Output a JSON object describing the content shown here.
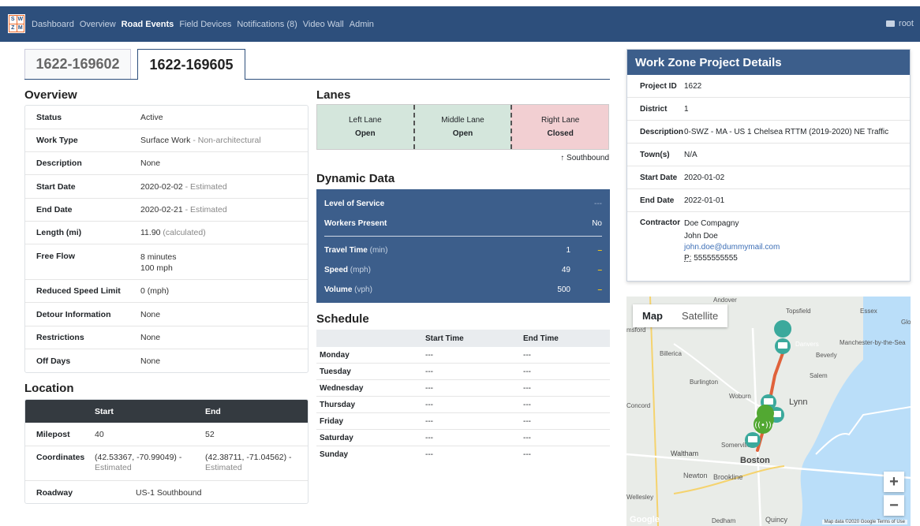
{
  "nav": {
    "items": [
      "Dashboard",
      "Overview",
      "Road Events",
      "Field Devices",
      "Notifications (8)",
      "Video Wall",
      "Admin"
    ],
    "active_index": 2,
    "user": "root"
  },
  "logo_letters": [
    "S",
    "W",
    "Z",
    "M"
  ],
  "tabs": [
    "1622-169602",
    "1622-169605"
  ],
  "overview": {
    "title": "Overview",
    "rows": [
      {
        "label": "Status",
        "value": "Active",
        "note": ""
      },
      {
        "label": "Work Type",
        "value": "Surface Work",
        "note": " - Non-architectural"
      },
      {
        "label": "Description",
        "value": "None",
        "note": ""
      },
      {
        "label": "Start Date",
        "value": "2020-02-02",
        "note": " - Estimated"
      },
      {
        "label": "End Date",
        "value": "2020-02-21",
        "note": " - Estimated"
      },
      {
        "label": "Length (mi)",
        "value": "11.90",
        "note": " (calculated)"
      },
      {
        "label": "Free Flow",
        "value": "8 minutes",
        "value2": "100 mph"
      },
      {
        "label": "Reduced Speed Limit",
        "value": "0 (mph)",
        "note": ""
      },
      {
        "label": "Detour Information",
        "value": "None",
        "note": ""
      },
      {
        "label": "Restrictions",
        "value": "None",
        "note": ""
      },
      {
        "label": "Off Days",
        "value": "None",
        "note": ""
      }
    ]
  },
  "location": {
    "title": "Location",
    "headers": [
      "Start",
      "End"
    ],
    "milepost": {
      "label": "Milepost",
      "start": "40",
      "end": "52"
    },
    "coordinates": {
      "label": "Coordinates",
      "start": "(42.53367, -70.99049) -",
      "end": "(42.38711, -71.04562) -",
      "note": "Estimated"
    },
    "roadway": {
      "label": "Roadway",
      "value": "US-1 Southbound"
    }
  },
  "lanes": {
    "title": "Lanes",
    "items": [
      {
        "name": "Left Lane",
        "status": "Open"
      },
      {
        "name": "Middle Lane",
        "status": "Open"
      },
      {
        "name": "Right Lane",
        "status": "Closed"
      }
    ],
    "direction": "↑ Southbound"
  },
  "dynamic": {
    "title": "Dynamic Data",
    "los_label": "Level of Service",
    "los_value": "---",
    "workers_label": "Workers Present",
    "workers_value": "No",
    "metrics": [
      {
        "label": "Travel Time",
        "unit": " (min)",
        "value": "1",
        "trend": "–"
      },
      {
        "label": "Speed",
        "unit": " (mph)",
        "value": "49",
        "trend": "–"
      },
      {
        "label": "Volume",
        "unit": " (vph)",
        "value": "500",
        "trend": "–"
      }
    ]
  },
  "schedule": {
    "title": "Schedule",
    "headers": [
      "",
      "Start Time",
      "End Time"
    ],
    "rows": [
      {
        "day": "Monday",
        "start": "---",
        "end": "---"
      },
      {
        "day": "Tuesday",
        "start": "---",
        "end": "---"
      },
      {
        "day": "Wednesday",
        "start": "---",
        "end": "---"
      },
      {
        "day": "Thursday",
        "start": "---",
        "end": "---"
      },
      {
        "day": "Friday",
        "start": "---",
        "end": "---"
      },
      {
        "day": "Saturday",
        "start": "---",
        "end": "---"
      },
      {
        "day": "Sunday",
        "start": "---",
        "end": "---"
      }
    ]
  },
  "workzone": {
    "title": "Work Zone Project Details",
    "project_id": {
      "label": "Project ID",
      "value": "1622"
    },
    "district": {
      "label": "District",
      "value": "1"
    },
    "description": {
      "label": "Description",
      "value": "0-SWZ - MA - US 1 Chelsea RTTM (2019-2020) NE Traffic"
    },
    "towns": {
      "label": "Town(s)",
      "value": "N/A"
    },
    "start": {
      "label": "Start Date",
      "value": "2020-01-02"
    },
    "end": {
      "label": "End Date",
      "value": "2022-01-01"
    },
    "contractor": {
      "label": "Contractor",
      "company": "Doe Compagny",
      "name": "John Doe",
      "email": "john.doe@dummymail.com",
      "phone_prefix": "P:",
      "phone": " 5555555555"
    }
  },
  "map": {
    "tabs": [
      "Map",
      "Satellite"
    ],
    "labels": [
      "Andover",
      "Topsfield",
      "Essex",
      "Danvers",
      "Manchester-by-the-Sea",
      "Beverly",
      "Billerica",
      "Salem",
      "Burlington",
      "Woburn",
      "Lynn",
      "Concord",
      "Somerville",
      "Waltham",
      "Boston",
      "Newton",
      "Brookline",
      "Wellesley",
      "Dedham",
      "Quincy",
      "Glou",
      "msford"
    ],
    "attribution": "Map data ©2020 Google   Terms of Use",
    "google": "Google"
  }
}
